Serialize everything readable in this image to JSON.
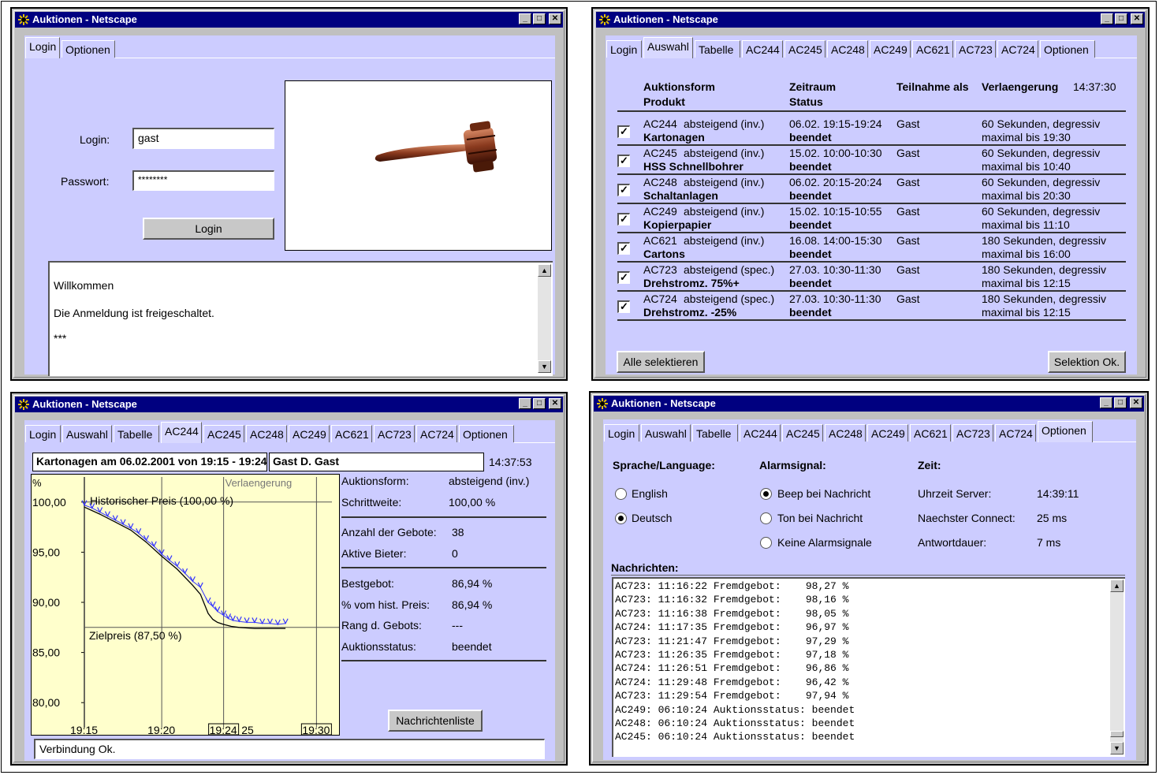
{
  "window_title": "Auktionen - Netscape",
  "w1": {
    "tabs": [
      "Login",
      "Optionen"
    ],
    "login_label": "Login:",
    "login_value": "gast",
    "password_label": "Passwort:",
    "password_value": "********",
    "login_button": "Login",
    "messages": [
      "Willkommen",
      "Die Anmeldung ist freigeschaltet.",
      "***"
    ]
  },
  "w2": {
    "tabs": [
      "Login",
      "Auswahl",
      "Tabelle",
      "AC244",
      "AC245",
      "AC248",
      "AC249",
      "AC621",
      "AC723",
      "AC724",
      "Optionen"
    ],
    "headers": {
      "form": "Auktionsform",
      "product": "Produkt",
      "period": "Zeitraum",
      "status": "Status",
      "participation": "Teilnahme als",
      "extension": "Verlaengerung",
      "time": "14:37:30"
    },
    "rows": [
      {
        "id": "AC244",
        "form": "absteigend (inv.)",
        "product": "Kartonagen",
        "period": "06.02. 19:15-19:24",
        "status": "beendet",
        "role": "Gast",
        "ext1": "60 Sekunden, degressiv",
        "ext2": "maximal bis 19:30"
      },
      {
        "id": "AC245",
        "form": "absteigend (inv.)",
        "product": "HSS Schnellbohrer",
        "period": "15.02. 10:00-10:30",
        "status": "beendet",
        "role": "Gast",
        "ext1": "60 Sekunden, degressiv",
        "ext2": "maximal bis 10:40"
      },
      {
        "id": "AC248",
        "form": "absteigend (inv.)",
        "product": "Schaltanlagen",
        "period": "06.02. 20:15-20:24",
        "status": "beendet",
        "role": "Gast",
        "ext1": "60 Sekunden, degressiv",
        "ext2": "maximal bis 20:30"
      },
      {
        "id": "AC249",
        "form": "absteigend (inv.)",
        "product": "Kopierpapier",
        "period": "15.02. 10:15-10:55",
        "status": "beendet",
        "role": "Gast",
        "ext1": "60 Sekunden, degressiv",
        "ext2": "maximal bis 11:10"
      },
      {
        "id": "AC621",
        "form": "absteigend (inv.)",
        "product": "Cartons",
        "period": "16.08. 14:00-15:30",
        "status": "beendet",
        "role": "Gast",
        "ext1": "180 Sekunden, degressiv",
        "ext2": "maximal bis 16:00"
      },
      {
        "id": "AC723",
        "form": "absteigend (spec.)",
        "product": "Drehstromz. 75%+",
        "period": "27.03. 10:30-11:30",
        "status": "beendet",
        "role": "Gast",
        "ext1": "180 Sekunden, degressiv",
        "ext2": "maximal bis 12:15"
      },
      {
        "id": "AC724",
        "form": "absteigend (spec.)",
        "product": "Drehstromz. -25%",
        "period": "27.03. 10:30-11:30",
        "status": "beendet",
        "role": "Gast",
        "ext1": "180 Sekunden, degressiv",
        "ext2": "maximal bis 12:15"
      }
    ],
    "select_all_button": "Alle selektieren",
    "selection_ok_button": "Selektion Ok."
  },
  "w3": {
    "tabs": [
      "Login",
      "Auswahl",
      "Tabelle",
      "AC244",
      "AC245",
      "AC248",
      "AC249",
      "AC621",
      "AC723",
      "AC724",
      "Optionen"
    ],
    "auction_title": "Kartonagen am 06.02.2001 von 19:15 - 19:24",
    "user": "Gast D. Gast",
    "time": "14:37:53",
    "info": [
      {
        "label": "Auktionsform:",
        "value": "absteigend (inv.)"
      },
      {
        "label": "Schrittweite:",
        "value": "100,00 %"
      },
      {
        "label": "Anzahl der Gebote:",
        "value": "38"
      },
      {
        "label": "Aktive Bieter:",
        "value": "0"
      },
      {
        "label": "Bestgebot:",
        "value": "86,94 %"
      },
      {
        "label": "% vom hist. Preis:",
        "value": "86,94 %"
      },
      {
        "label": "Rang d. Gebots:",
        "value": "---"
      },
      {
        "label": "Auktionsstatus:",
        "value": "beendet"
      }
    ],
    "messages_button": "Nachrichtenliste",
    "status": "Verbindung Ok."
  },
  "chart_data": {
    "type": "line",
    "ylabel": "%",
    "yticks": [
      "100,00",
      "95,00",
      "90,00",
      "85,00",
      "80,00"
    ],
    "ytick_values": [
      100,
      95,
      90,
      85,
      80
    ],
    "xticks": [
      "19:15",
      "19:20",
      "19:24",
      "25",
      "19:30"
    ],
    "xtick_values": [
      0,
      5,
      9,
      10,
      15
    ],
    "annotations": {
      "historic": "Historischer Preis (100,00 %)",
      "target": "Zielpreis (87,50 %)",
      "extension": "Verlaengerung"
    },
    "historic_price": 100,
    "target_price": 87.5,
    "bid_series": {
      "x": [
        0,
        0.5,
        1,
        1.5,
        2,
        2.5,
        3,
        3.5,
        4,
        4.5,
        5,
        5.5,
        6,
        6.5,
        7,
        7.5,
        8,
        8.3,
        8.6,
        9,
        9.3,
        9.6,
        10,
        10.5,
        11,
        11.5,
        12,
        12.5,
        13
      ],
      "y": [
        99.7,
        99.4,
        99.0,
        98.6,
        98.2,
        97.8,
        97.4,
        96.9,
        96.2,
        95.6,
        94.8,
        94.2,
        93.6,
        92.9,
        92.1,
        91.5,
        90.0,
        89.6,
        89.1,
        88.7,
        88.4,
        88.2,
        88.1,
        88.0,
        88.0,
        87.9,
        87.9,
        87.8,
        87.9
      ]
    },
    "price_line": {
      "x": [
        0,
        1,
        2,
        3,
        4,
        5,
        6,
        7,
        7.5,
        8,
        8.3,
        8.6,
        9,
        9.5,
        10,
        11,
        12,
        13
      ],
      "y": [
        99.5,
        98.8,
        98.0,
        97.2,
        96.0,
        94.6,
        93.3,
        91.7,
        90.8,
        88.9,
        88.3,
        88.0,
        87.8,
        87.6,
        87.5,
        87.4,
        87.4,
        87.4
      ]
    },
    "xlim": [
      0,
      16
    ],
    "ylim": [
      77.5,
      102.5
    ]
  },
  "w4": {
    "tabs": [
      "Login",
      "Auswahl",
      "Tabelle",
      "AC244",
      "AC245",
      "AC248",
      "AC249",
      "AC621",
      "AC723",
      "AC724",
      "Optionen"
    ],
    "lang_header": "Sprache/Language:",
    "alarm_header": "Alarmsignal:",
    "time_header": "Zeit:",
    "languages": [
      {
        "label": "English",
        "selected": false
      },
      {
        "label": "Deutsch",
        "selected": true
      }
    ],
    "alarms": [
      {
        "label": "Beep bei Nachricht",
        "selected": true
      },
      {
        "label": "Ton bei Nachricht",
        "selected": false
      },
      {
        "label": "Keine Alarmsignale",
        "selected": false
      }
    ],
    "times": [
      {
        "label": "Uhrzeit Server:",
        "value": "14:39:11"
      },
      {
        "label": "Naechster Connect:",
        "value": "25 ms"
      },
      {
        "label": "Antwortdauer:",
        "value": "7 ms"
      }
    ],
    "messages_header": "Nachrichten:",
    "messages": [
      "AC723: 11:16:22 Fremdgebot:    98,27 %",
      "AC723: 11:16:32 Fremdgebot:    98,16 %",
      "AC723: 11:16:38 Fremdgebot:    98,05 %",
      "AC724: 11:17:35 Fremdgebot:    96,97 %",
      "AC723: 11:21:47 Fremdgebot:    97,29 %",
      "AC723: 11:26:35 Fremdgebot:    97,18 %",
      "AC724: 11:26:51 Fremdgebot:    96,86 %",
      "AC724: 11:29:48 Fremdgebot:    96,42 %",
      "AC723: 11:29:54 Fremdgebot:    97,94 %",
      "AC249: 06:10:24 Auktionsstatus: beendet",
      "AC248: 06:10:24 Auktionsstatus: beendet",
      "AC245: 06:10:24 Auktionsstatus: beendet"
    ]
  },
  "colors": {
    "titlebar": "#000080",
    "panel": "#ccccff",
    "chart_bg": "#ffffcc",
    "bids": "#3333ff"
  },
  "icons": [
    "netscape-icon",
    "minimize-icon",
    "maximize-icon",
    "close-icon",
    "gavel-icon",
    "scroll-up-icon",
    "scroll-down-icon"
  ]
}
